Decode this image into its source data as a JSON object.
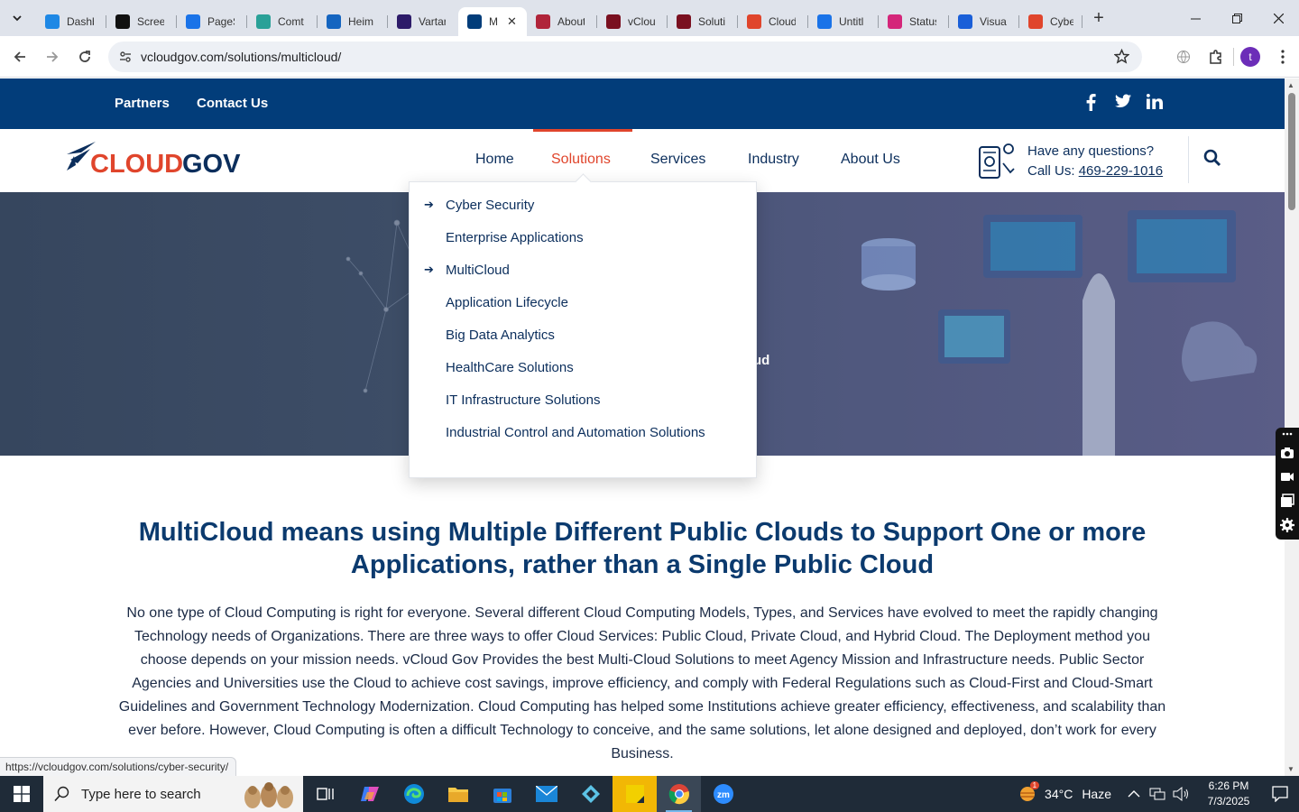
{
  "browser": {
    "tabs": [
      {
        "label": "Dashb",
        "icon": "dashboard-icon",
        "color": "#1e88e5"
      },
      {
        "label": "Scree",
        "icon": "screencast-icon",
        "color": "#111111"
      },
      {
        "label": "PageS",
        "icon": "pagespeed-icon",
        "color": "#1a73e8"
      },
      {
        "label": "Comt",
        "icon": "comet-icon",
        "color": "#2aa198"
      },
      {
        "label": "Heim",
        "icon": "heimdal-icon",
        "color": "#1565c0"
      },
      {
        "label": "Vartar",
        "icon": "vartar-icon",
        "color": "#2d1b69"
      },
      {
        "label": "M",
        "icon": "vcloudgov-icon",
        "color": "#023d7a",
        "active": true
      },
      {
        "label": "About",
        "icon": "about-icon",
        "color": "#b0243a"
      },
      {
        "label": "vClou",
        "icon": "vcloud-icon",
        "color": "#7a1020"
      },
      {
        "label": "Soluti",
        "icon": "solutions-icon",
        "color": "#7a1020"
      },
      {
        "label": "Cloud",
        "icon": "cloud-icon",
        "color": "#e0452c"
      },
      {
        "label": "Untitl",
        "icon": "docs-icon",
        "color": "#1a73e8"
      },
      {
        "label": "Status",
        "icon": "status-icon",
        "color": "#d4267a"
      },
      {
        "label": "Visua",
        "icon": "visual-icon",
        "color": "#1a5fd8"
      },
      {
        "label": "Cyber",
        "icon": "cyber-icon",
        "color": "#e0452c"
      }
    ],
    "url": "vcloudgov.com/solutions/multicloud/",
    "profile_initial": "t",
    "status_url": "https://vcloudgov.com/solutions/cyber-security/"
  },
  "site": {
    "topbar": {
      "links": [
        "Partners",
        "Contact Us"
      ]
    },
    "logo": {
      "text_cloud": "CLOUD",
      "text_gov": "GOV",
      "red": "#e0452c",
      "navy": "#0b2e5c"
    },
    "nav": {
      "items": [
        "Home",
        "Solutions",
        "Services",
        "Industry",
        "About Us"
      ],
      "active": "Solutions"
    },
    "contact": {
      "question": "Have any questions?",
      "call_prefix": "Call Us: ",
      "phone": "469-229-1016"
    },
    "hero": {
      "partial_text": "ud"
    },
    "dropdown": {
      "items": [
        {
          "label": "Cyber Security",
          "arrow": true
        },
        {
          "label": "Enterprise Applications",
          "arrow": false
        },
        {
          "label": "MultiCloud",
          "arrow": true
        },
        {
          "label": "Application Lifecycle",
          "arrow": false
        },
        {
          "label": "Big Data Analytics",
          "arrow": false
        },
        {
          "label": "HealthCare Solutions",
          "arrow": false
        },
        {
          "label": "IT Infrastructure Solutions",
          "arrow": false
        },
        {
          "label": "Industrial Control and Automation Solutions",
          "arrow": false
        }
      ]
    },
    "content": {
      "title": "MultiCloud means using Multiple Different Public Clouds to Support One or more Applications, rather than a Single Public Cloud",
      "body": "No one type of Cloud Computing is right for everyone. Several different Cloud Computing Models, Types, and Services have evolved to meet the rapidly changing Technology needs of Organizations. There are three ways to offer Cloud Services: Public Cloud, Private Cloud, and Hybrid Cloud. The Deployment method you choose depends on your mission needs. vCloud Gov Provides the best Multi-Cloud Solutions to meet Agency Mission and Infrastructure needs. Public Sector Agencies and Universities use the Cloud to achieve cost savings, improve efficiency, and comply with Federal Regulations such as Cloud-First and Cloud-Smart Guidelines and Government Technology Modernization. Cloud Computing has helped some Institutions achieve greater efficiency, effectiveness, and scalability than ever before. However, Cloud Computing is often a difficult Technology to conceive, and the same solutions, let alone designed and deployed, don’t work for every Business."
    }
  },
  "taskbar": {
    "search_placeholder": "Type here to search",
    "weather_temp": "34°C",
    "weather_desc": "Haze",
    "time": "6:26 PM",
    "date": "7/3/2025",
    "notification_badge": "1"
  },
  "colors": {
    "brand_navy": "#023d7a",
    "accent_red": "#e0452c",
    "text_navy": "#0b2e5c"
  }
}
